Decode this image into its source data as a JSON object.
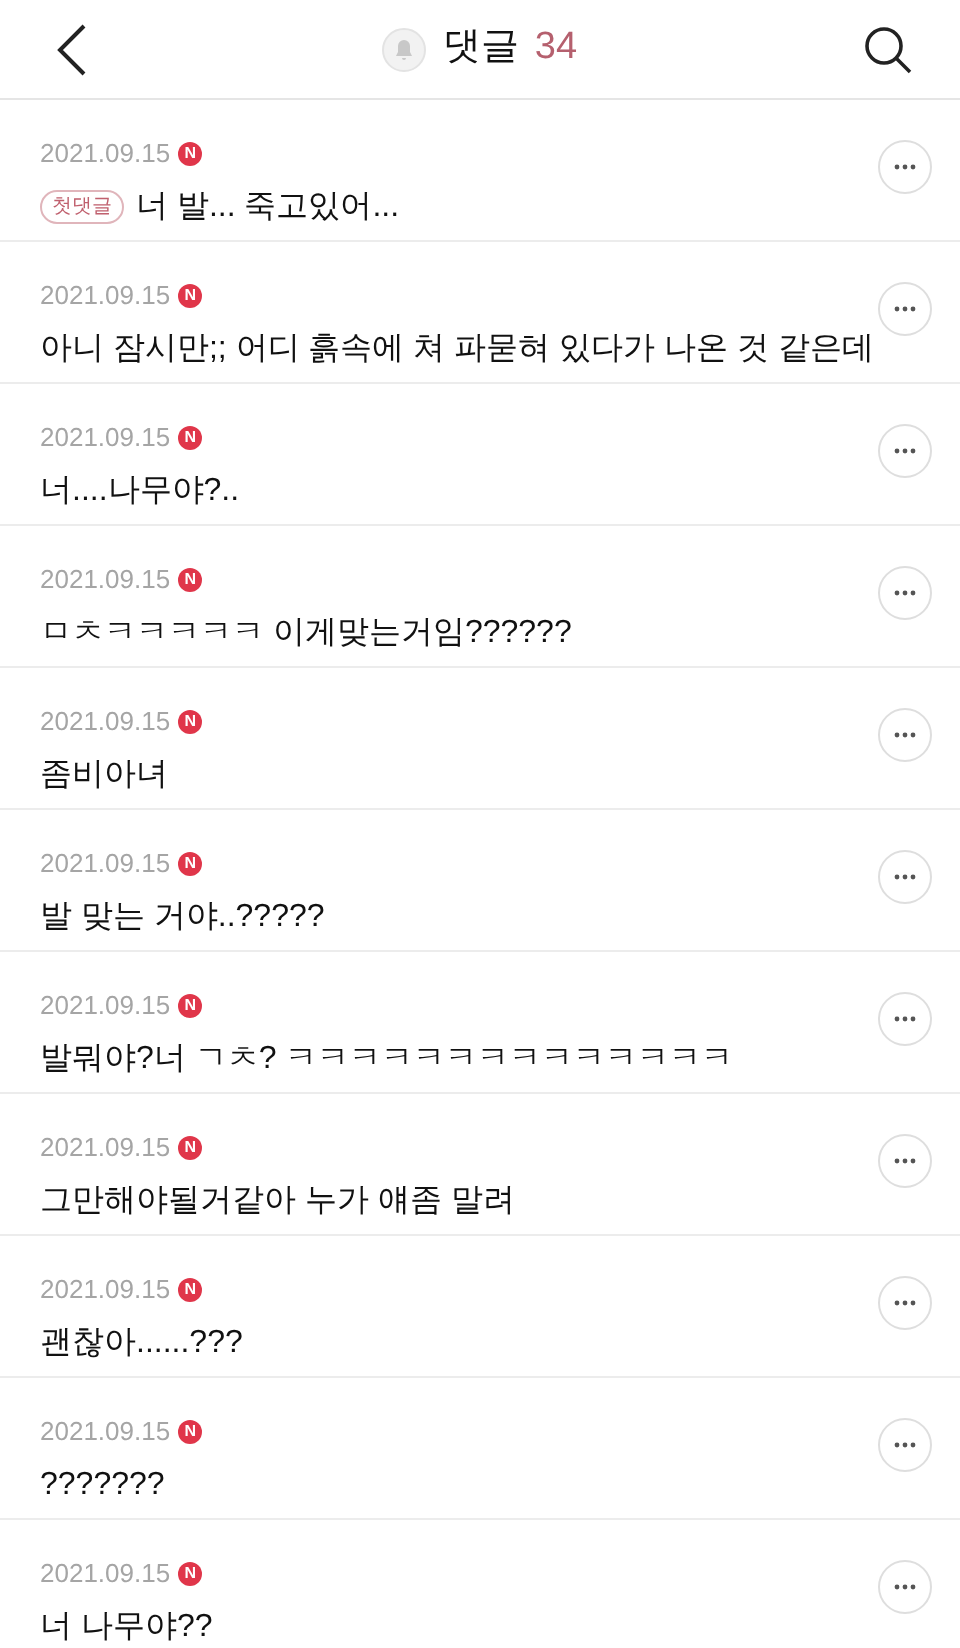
{
  "header": {
    "title": "댓글",
    "count": "34"
  },
  "comments": [
    {
      "date": "2021.09.15",
      "badge": "N",
      "tag": "첫댓글",
      "text": "너 발... 죽고있어..."
    },
    {
      "date": "2021.09.15",
      "badge": "N",
      "text": "아니 잠시만;; 어디 흙속에 쳐 파묻혀 있다가 나온 것 같은데"
    },
    {
      "date": "2021.09.15",
      "badge": "N",
      "text": "너....나무야?.."
    },
    {
      "date": "2021.09.15",
      "badge": "N",
      "text": "ㅁㅊㅋㅋㅋㅋㅋ 이게맞는거임??????"
    },
    {
      "date": "2021.09.15",
      "badge": "N",
      "text": "좀비아녀"
    },
    {
      "date": "2021.09.15",
      "badge": "N",
      "text": "발 맞는 거야..?????"
    },
    {
      "date": "2021.09.15",
      "badge": "N",
      "text": "발뭐야?너 ㄱㅊ? ㅋㅋㅋㅋㅋㅋㅋㅋㅋㅋㅋㅋㅋㅋ"
    },
    {
      "date": "2021.09.15",
      "badge": "N",
      "text": "그만해야될거같아 누가 얘좀 말려"
    },
    {
      "date": "2021.09.15",
      "badge": "N",
      "text": "괜찮아......???"
    },
    {
      "date": "2021.09.15",
      "badge": "N",
      "text": "???????"
    },
    {
      "date": "2021.09.15",
      "badge": "N",
      "text": "너 나무야??"
    }
  ]
}
